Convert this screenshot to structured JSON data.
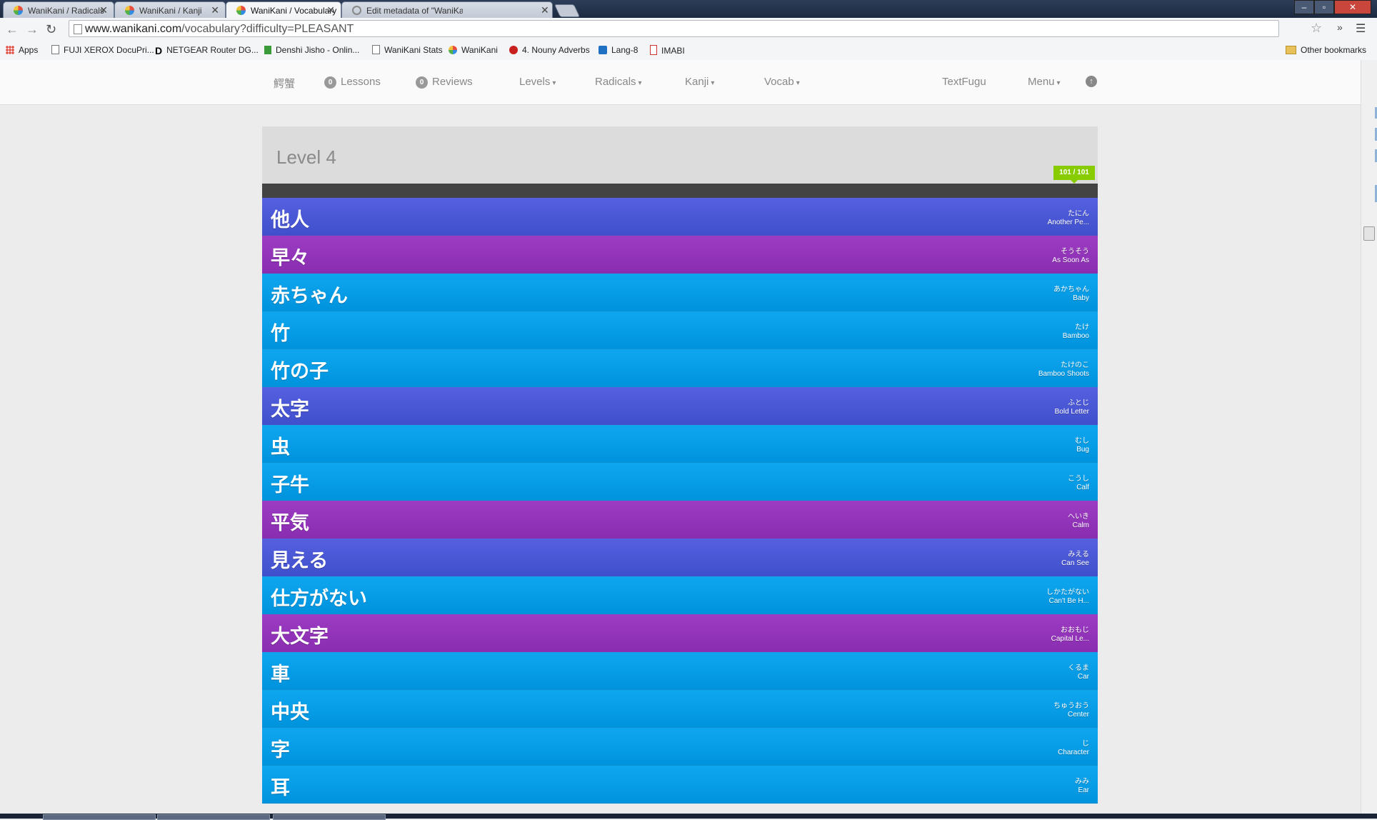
{
  "browser": {
    "tabs": [
      {
        "title": "WaniKani / Radicals",
        "active": false,
        "icon": "wanikani-favicon"
      },
      {
        "title": "WaniKani / Kanji",
        "active": false,
        "icon": "wanikani-favicon"
      },
      {
        "title": "WaniKani / Vocabulary",
        "active": true,
        "icon": "wanikani-favicon"
      },
      {
        "title": "Edit metadata of \"WaniKa",
        "active": false,
        "icon": "loading-icon"
      }
    ],
    "url_domain": "www.wanikani.com",
    "url_path": "/vocabulary?difficulty=PLEASANT",
    "bookmarks": [
      {
        "label": "Apps",
        "icon": "apps-icon"
      },
      {
        "label": "FUJI XEROX DocuPri...",
        "icon": "page-icon"
      },
      {
        "label": "NETGEAR Router DG...",
        "icon": "netgear-icon"
      },
      {
        "label": "Denshi Jisho - Onlin...",
        "icon": "jisho-icon"
      },
      {
        "label": "WaniKani Stats",
        "icon": "page-icon"
      },
      {
        "label": "WaniKani",
        "icon": "wanikani-icon"
      },
      {
        "label": "4. Nouny Adverbs",
        "icon": "tomato-icon"
      },
      {
        "label": "Lang-8",
        "icon": "check-icon"
      },
      {
        "label": "IMABI",
        "icon": "imabi-icon"
      }
    ],
    "other_bookmarks": "Other bookmarks"
  },
  "nav": {
    "logo_text": "鰐蟹",
    "lessons_count": "0",
    "lessons_label": "Lessons",
    "reviews_count": "0",
    "reviews_label": "Reviews",
    "levels": "Levels",
    "radicals": "Radicals",
    "kanji": "Kanji",
    "vocab": "Vocab",
    "textfugu": "TextFugu",
    "menu": "Menu"
  },
  "level": {
    "title": "Level 4",
    "progress_text": "101 / 101",
    "progress_fraction": 1.0
  },
  "vocab_items": [
    {
      "character": "他人",
      "reading": "たにん",
      "meaning": "Another Pe...",
      "srs": "guru"
    },
    {
      "character": "早々",
      "reading": "そうそう",
      "meaning": "As Soon As",
      "srs": "apprentice"
    },
    {
      "character": "赤ちゃん",
      "reading": "あかちゃん",
      "meaning": "Baby",
      "srs": "vocabulary"
    },
    {
      "character": "竹",
      "reading": "たけ",
      "meaning": "Bamboo",
      "srs": "vocabulary"
    },
    {
      "character": "竹の子",
      "reading": "たけのこ",
      "meaning": "Bamboo Shoots",
      "srs": "vocabulary"
    },
    {
      "character": "太字",
      "reading": "ふとじ",
      "meaning": "Bold Letter",
      "srs": "guru"
    },
    {
      "character": "虫",
      "reading": "むし",
      "meaning": "Bug",
      "srs": "vocabulary"
    },
    {
      "character": "子牛",
      "reading": "こうし",
      "meaning": "Calf",
      "srs": "vocabulary"
    },
    {
      "character": "平気",
      "reading": "へいき",
      "meaning": "Calm",
      "srs": "apprentice"
    },
    {
      "character": "見える",
      "reading": "みえる",
      "meaning": "Can See",
      "srs": "guru"
    },
    {
      "character": "仕方がない",
      "reading": "しかたがない",
      "meaning": "Can't Be H...",
      "srs": "vocabulary"
    },
    {
      "character": "大文字",
      "reading": "おおもじ",
      "meaning": "Capital Le...",
      "srs": "apprentice"
    },
    {
      "character": "車",
      "reading": "くるま",
      "meaning": "Car",
      "srs": "vocabulary"
    },
    {
      "character": "中央",
      "reading": "ちゅうおう",
      "meaning": "Center",
      "srs": "vocabulary"
    },
    {
      "character": "字",
      "reading": "じ",
      "meaning": "Character",
      "srs": "vocabulary"
    },
    {
      "character": "耳",
      "reading": "みみ",
      "meaning": "Ear",
      "srs": "vocabulary"
    }
  ],
  "colors": {
    "vocabulary": "#0093dd",
    "apprentice": "#8a2db0",
    "guru": "#4050cc",
    "progress": "#88cc00"
  }
}
